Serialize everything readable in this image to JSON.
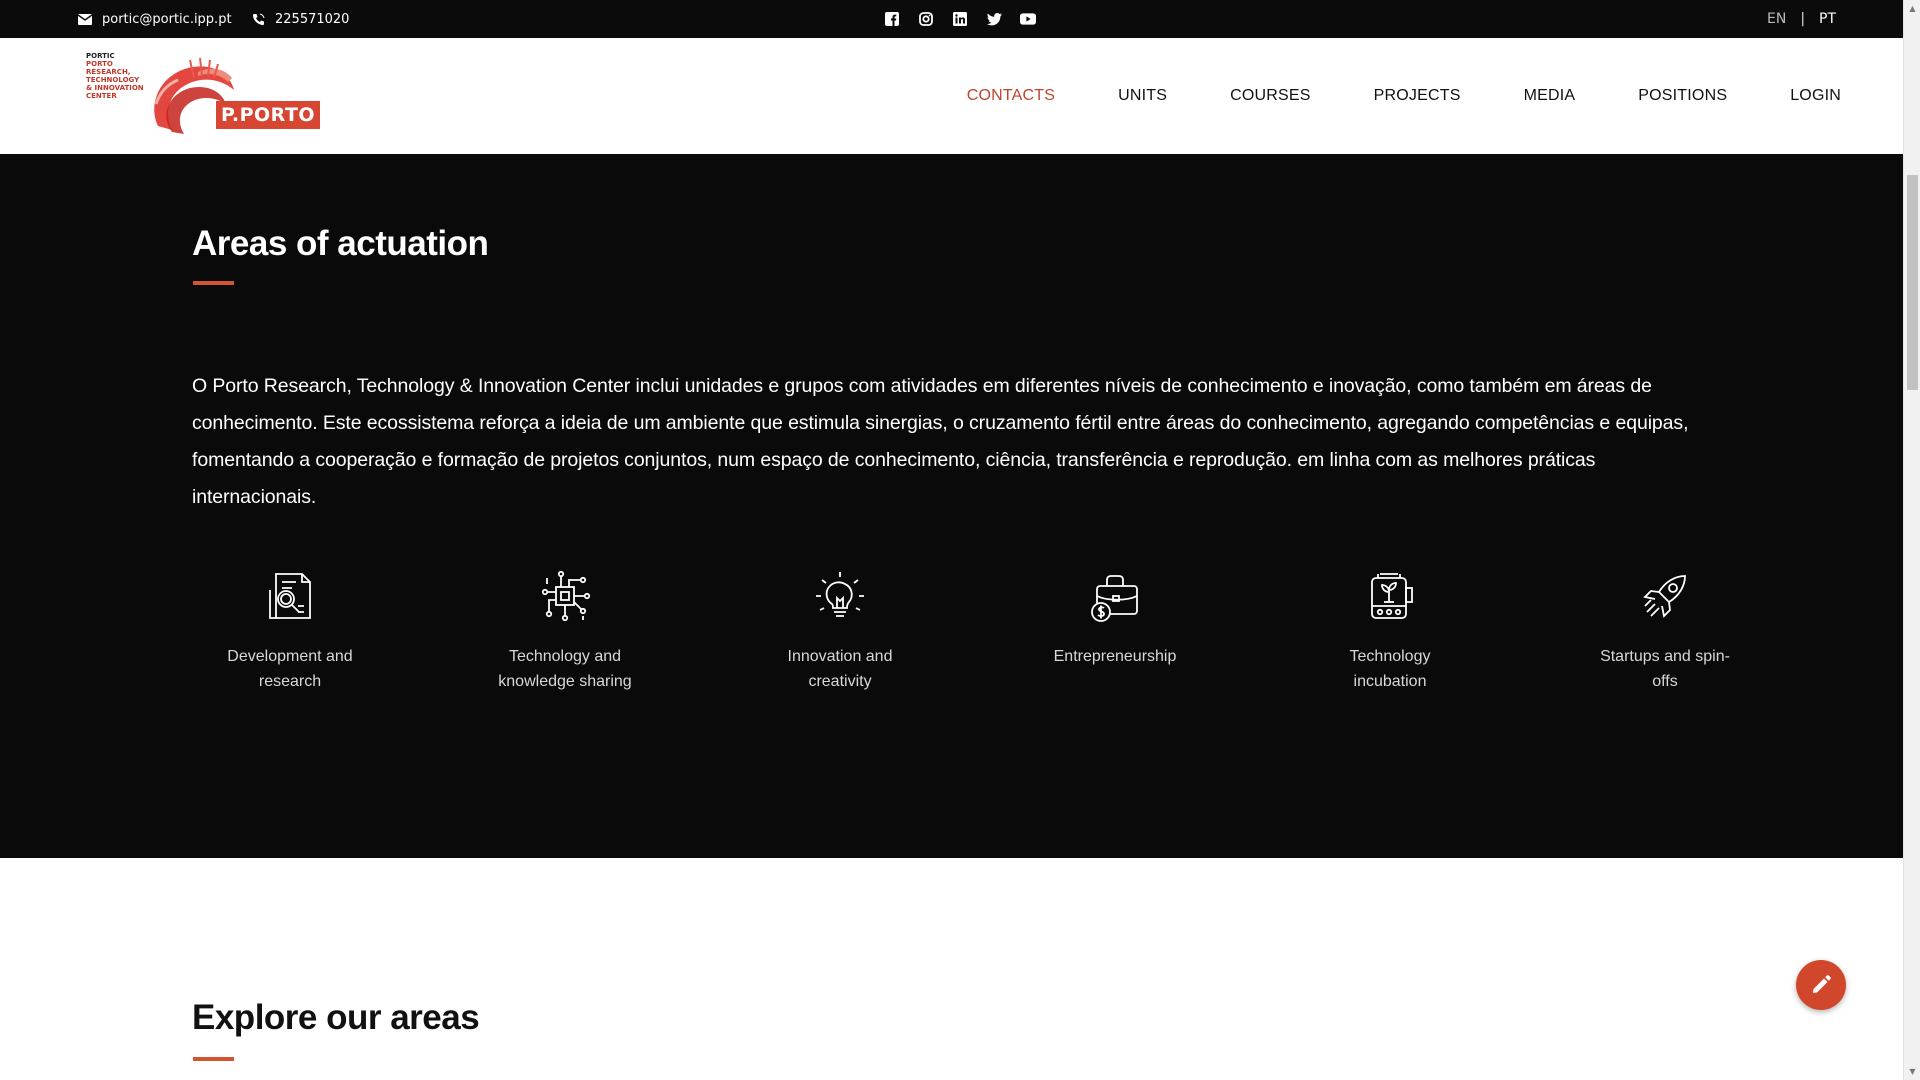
{
  "topbar": {
    "email": "portic@portic.ipp.pt",
    "phone": "225571020",
    "social": [
      "facebook-icon",
      "instagram-icon",
      "linkedin-icon",
      "twitter-icon",
      "youtube-icon"
    ],
    "lang_en": "EN",
    "lang_sep": "|",
    "lang_pt": "PT"
  },
  "logo": {
    "lines": [
      "PORTIC",
      "PORTO",
      "RESEARCH,",
      "TECHNOLOGY",
      "& INNOVATION",
      "CENTER"
    ],
    "badge": "P.PORTO"
  },
  "nav": {
    "items": [
      "CONTACTS",
      "UNITS",
      "COURSES",
      "PROJECTS",
      "MEDIA",
      "POSITIONS",
      "LOGIN"
    ],
    "active": "CONTACTS"
  },
  "areas_section": {
    "title": "Areas of actuation",
    "intro": "O Porto Research, Technology & Innovation Center inclui unidades e grupos com atividades em diferentes níveis de conhecimento e inovação, como também em áreas de conhecimento. Este ecossistema reforça a ideia de um ambiente que estimula sinergias, o cruzamento fértil entre áreas do conhecimento, agregando competências e equipas, fomentando a cooperação e formação de projetos conjuntos, num espaço de conhecimento, ciência, transferência e reprodução. em linha com as melhores práticas internacionais.",
    "items": [
      {
        "label_1": "Development and",
        "label_2": "research",
        "icon": "research-document-icon"
      },
      {
        "label_1": "Technology and",
        "label_2": "knowledge sharing",
        "icon": "circuit-chip-icon"
      },
      {
        "label_1": "Innovation and",
        "label_2": "creativity",
        "icon": "lightbulb-icon"
      },
      {
        "label_1": "Entrepreneurship",
        "label_2": "",
        "icon": "briefcase-money-icon"
      },
      {
        "label_1": "Technology",
        "label_2": "incubation",
        "icon": "incubator-icon"
      },
      {
        "label_1": "Startups and spin-",
        "label_2": "offs",
        "icon": "rocket-icon"
      }
    ]
  },
  "explore_section": {
    "title": "Explore our areas"
  },
  "colors": {
    "accent": "#d0472c",
    "dark_bg": "#0a0a0a",
    "topbar_bg": "#0b0b0b"
  }
}
